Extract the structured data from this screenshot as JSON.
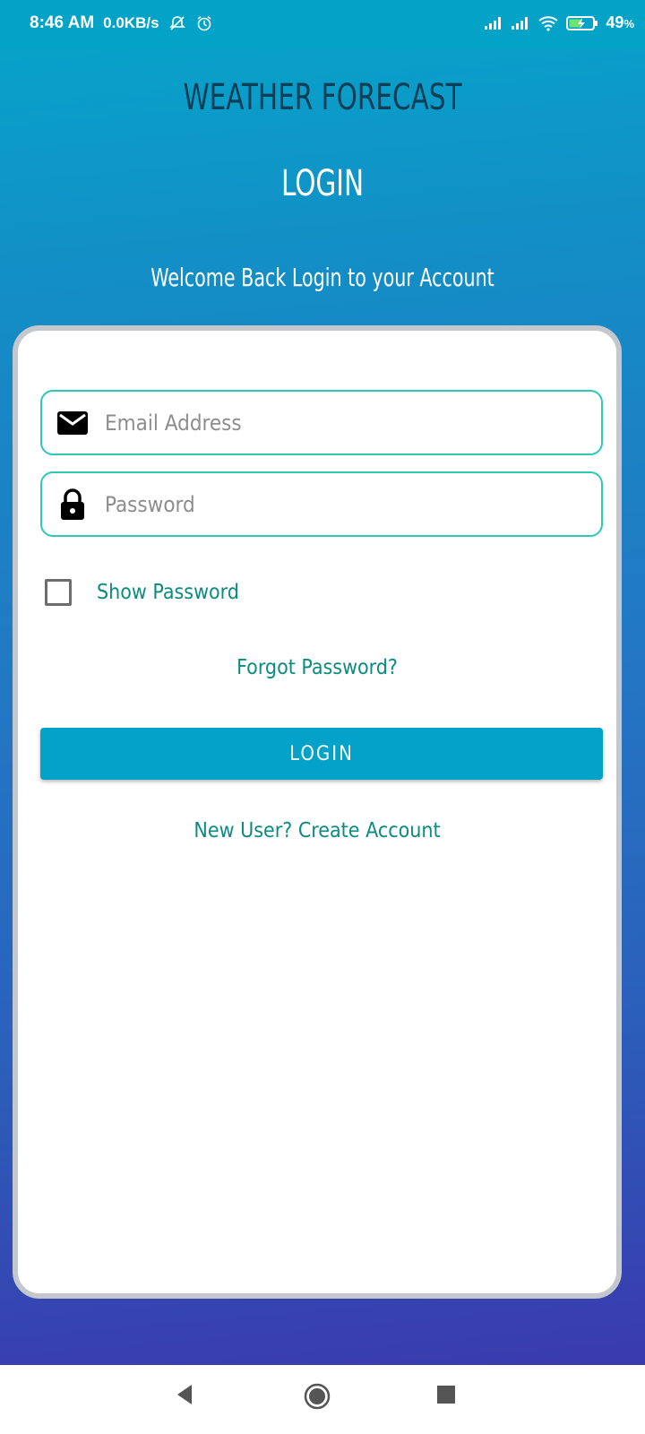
{
  "status_bar": {
    "time": "8:46 AM",
    "network_speed": "0.0KB/s",
    "battery_percent": "49",
    "battery_suffix": "%",
    "icons": [
      "mute-notification-icon",
      "alarm-icon",
      "signal-icon",
      "signal-icon",
      "wifi-icon",
      "battery-charging-icon"
    ]
  },
  "header": {
    "app_title": "WEATHER FORECAST",
    "page_title": "LOGIN",
    "subtitle": "Welcome Back Login to your Account"
  },
  "form": {
    "email_placeholder": "Email Address",
    "email_value": "",
    "password_placeholder": "Password",
    "password_value": "",
    "show_password_label": "Show Password",
    "show_password_checked": false,
    "forgot_password": "Forgot Password?",
    "login_button": "LOGIN",
    "create_account": "New User? Create Account"
  },
  "colors": {
    "accent": "#03a2c8",
    "field_border": "#2ec8b7",
    "link": "#0c8b7f",
    "title_dark": "#0b3e57"
  },
  "nav_bar": {
    "icons": [
      "back-icon",
      "home-icon",
      "recents-icon"
    ]
  }
}
